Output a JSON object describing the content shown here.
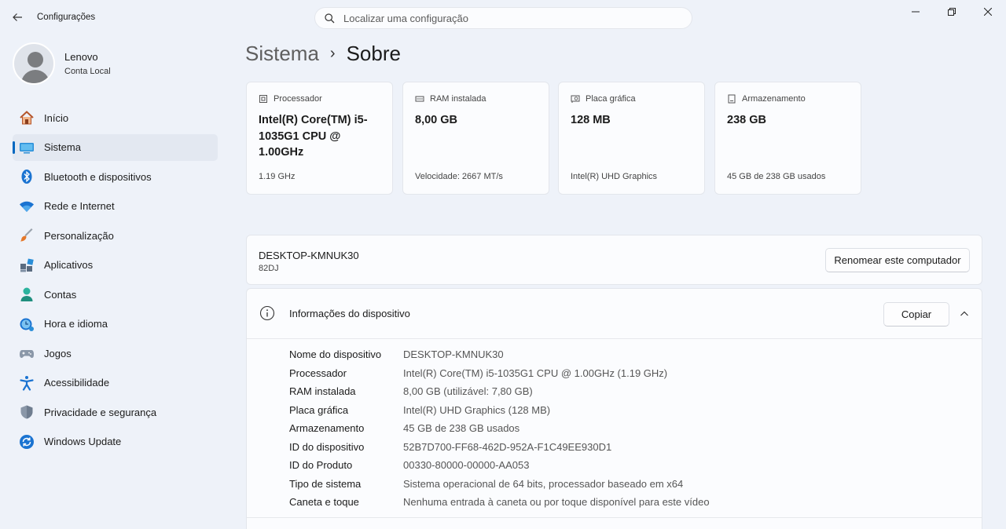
{
  "window": {
    "title": "Configurações",
    "back_icon": "arrow-left-icon",
    "controls": [
      "minimize-icon",
      "maximize-icon",
      "close-icon"
    ]
  },
  "search": {
    "placeholder": "Localizar uma configuração",
    "value": ""
  },
  "profile": {
    "name": "Lenovo",
    "account": "Conta Local"
  },
  "sidebar": {
    "items": [
      {
        "label": "Início",
        "icon": "home-icon",
        "active": false
      },
      {
        "label": "Sistema",
        "icon": "system-icon",
        "active": true
      },
      {
        "label": "Bluetooth e dispositivos",
        "icon": "bluetooth-icon",
        "active": false
      },
      {
        "label": "Rede e Internet",
        "icon": "wifi-icon",
        "active": false
      },
      {
        "label": "Personalização",
        "icon": "brush-icon",
        "active": false
      },
      {
        "label": "Aplicativos",
        "icon": "apps-icon",
        "active": false
      },
      {
        "label": "Contas",
        "icon": "person-icon",
        "active": false
      },
      {
        "label": "Hora e idioma",
        "icon": "clock-globe-icon",
        "active": false
      },
      {
        "label": "Jogos",
        "icon": "gamepad-icon",
        "active": false
      },
      {
        "label": "Acessibilidade",
        "icon": "accessibility-icon",
        "active": false
      },
      {
        "label": "Privacidade e segurança",
        "icon": "shield-icon",
        "active": false
      },
      {
        "label": "Windows Update",
        "icon": "update-icon",
        "active": false
      }
    ]
  },
  "breadcrumb": {
    "parent": "Sistema",
    "separator": "›",
    "current": "Sobre"
  },
  "specs": [
    {
      "title": "Processador",
      "icon": "processor-icon",
      "value": "Intel(R) Core(TM) i5-1035G1 CPU @ 1.00GHz",
      "detail": "1.19 GHz"
    },
    {
      "title": "RAM instalada",
      "icon": "ram-icon",
      "value": "8,00 GB",
      "detail": "Velocidade: 2667 MT/s"
    },
    {
      "title": "Placa gráfica",
      "icon": "gpu-icon",
      "value": "128 MB",
      "detail": "Intel(R) UHD Graphics"
    },
    {
      "title": "Armazenamento",
      "icon": "storage-icon",
      "value": "238 GB",
      "detail": "45 GB de 238 GB usados"
    }
  ],
  "computer": {
    "name": "DESKTOP-KMNUK30",
    "model": "82DJ",
    "rename_label": "Renomear este computador"
  },
  "device_info": {
    "title": "Informações do dispositivo",
    "copy_label": "Copiar",
    "rows": [
      {
        "label": "Nome do dispositivo",
        "value": "DESKTOP-KMNUK30"
      },
      {
        "label": "Processador",
        "value": "Intel(R) Core(TM) i5-1035G1 CPU @ 1.00GHz   (1.19 GHz)"
      },
      {
        "label": "RAM instalada",
        "value": "8,00 GB (utilizável: 7,80 GB)"
      },
      {
        "label": "Placa gráfica",
        "value": "Intel(R) UHD Graphics (128 MB)"
      },
      {
        "label": "Armazenamento",
        "value": "45 GB de 238 GB usados"
      },
      {
        "label": "ID do dispositivo",
        "value": "52B7D700-FF68-462D-952A-F1C49EE930D1"
      },
      {
        "label": "ID do Produto",
        "value": "00330-80000-00000-AA053"
      },
      {
        "label": "Tipo de sistema",
        "value": "Sistema operacional de 64 bits, processador baseado em x64"
      },
      {
        "label": "Caneta e toque",
        "value": "Nenhuma entrada à caneta ou por toque disponível para este vídeo"
      }
    ]
  },
  "colors": {
    "accent": "#0067c0",
    "background": "#eef2f9",
    "card": "#fbfcfe"
  }
}
